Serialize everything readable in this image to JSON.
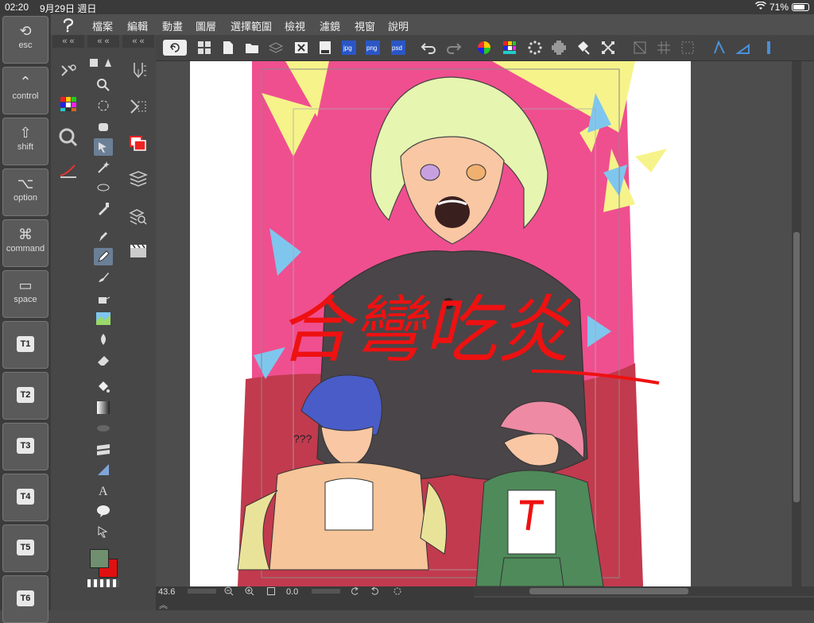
{
  "status": {
    "time": "02:20",
    "date": "9月29日 週日",
    "battery": "71%"
  },
  "keys": [
    {
      "glyph": "⟲",
      "label": "esc"
    },
    {
      "glyph": "⌃",
      "label": "control"
    },
    {
      "glyph": "⇧",
      "label": "shift"
    },
    {
      "glyph": "⌥",
      "label": "option"
    },
    {
      "glyph": "⌘",
      "label": "command"
    },
    {
      "glyph": "▭",
      "label": "space"
    },
    {
      "tkey": "T1"
    },
    {
      "tkey": "T2"
    },
    {
      "tkey": "T3"
    },
    {
      "tkey": "T4"
    },
    {
      "tkey": "T5"
    },
    {
      "tkey": "T6"
    }
  ],
  "menu": [
    "檔案",
    "編輯",
    "動畫",
    "圖層",
    "選擇範圍",
    "檢視",
    "濾鏡",
    "視窗",
    "說明"
  ],
  "toolbar_icons": [
    "undo-history-icon",
    "grid-icon",
    "new-file-icon",
    "open-file-icon",
    "layer-stack-icon",
    "close-doc-icon",
    "save-icon",
    "jpg-export-icon",
    "png-export-icon",
    "psd-export-icon",
    "undo-icon",
    "redo-icon",
    "color-wheel-icon",
    "palette-icon",
    "spinner-icon",
    "gear-icon",
    "fill-icon",
    "transform-icon",
    "crop-icon",
    "grid-toggle-icon",
    "frame-icon",
    "ruler-icon",
    "perspective-icon",
    "pen-icon"
  ],
  "toolbar_export_labels": {
    "jpg": "jpg",
    "png": "png",
    "psd": "psd"
  },
  "bottom": {
    "zoom": "43.6",
    "angle": "0.0"
  },
  "colors": {
    "main": "#6f8f6f",
    "sub": "#e01010",
    "accent": "#6b7f96"
  },
  "canvas": {
    "title_scribble": "合彎吃炎",
    "annotation": "???"
  }
}
